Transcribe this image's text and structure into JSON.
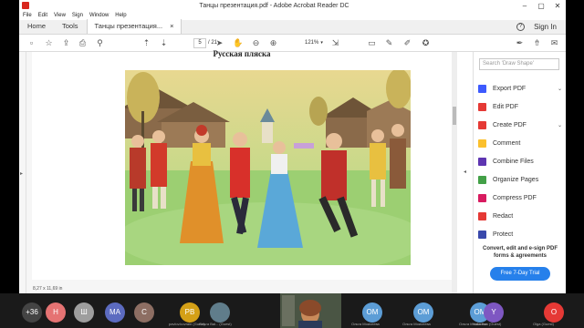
{
  "window": {
    "title": "Танцы презентация.pdf - Adobe Acrobat Reader DC",
    "controls": [
      "–",
      "▢",
      "✕"
    ]
  },
  "menu": [
    "File",
    "Edit",
    "View",
    "Sign",
    "Window",
    "Help"
  ],
  "tabs": {
    "home": "Home",
    "tools": "Tools",
    "document": "Танцы презентация...",
    "document_close": "×",
    "help": "?",
    "sign_in": "Sign In"
  },
  "toolbar": {
    "page_current": "5",
    "page_total": "/ 21",
    "zoom": "121%"
  },
  "document": {
    "heading": "Русская пляска",
    "page_size": "8,27 x 11,69 in"
  },
  "right_pane": {
    "search_placeholder": "Search 'Draw Shape'",
    "tools": [
      {
        "label": "Export PDF",
        "color": "#3d5afe",
        "has_menu": true
      },
      {
        "label": "Edit PDF",
        "color": "#e53935",
        "has_menu": false
      },
      {
        "label": "Create PDF",
        "color": "#e53935",
        "has_menu": true
      },
      {
        "label": "Comment",
        "color": "#fbc02d",
        "has_menu": false
      },
      {
        "label": "Combine Files",
        "color": "#5e35b1",
        "has_menu": false
      },
      {
        "label": "Organize Pages",
        "color": "#43a047",
        "has_menu": false
      },
      {
        "label": "Compress PDF",
        "color": "#d81b60",
        "has_menu": false
      },
      {
        "label": "Redact",
        "color": "#e53935",
        "has_menu": false
      },
      {
        "label": "Protect",
        "color": "#3949ab",
        "has_menu": false
      }
    ],
    "promo_line1": "Convert, edit and e-sign PDF",
    "promo_line2": "forms & agreements",
    "trial_button": "Free 7-Day Trial"
  },
  "participants": [
    {
      "label": "+36",
      "color": "#444444"
    },
    {
      "label": "Н",
      "color": "#e57373"
    },
    {
      "label": "Ш",
      "color": "#9e9e9e"
    },
    {
      "label": "МА",
      "color": "#5c6bc0"
    },
    {
      "label": "С",
      "color": "#8d6e63"
    },
    {
      "label": "PB",
      "color": "#d4a017",
      "name": "pavlov.kovrain (Guest)"
    },
    {
      "label": "",
      "color": "#607d8b",
      "name": "Ольга Bal... (Guest)"
    },
    {
      "label": "",
      "color": "#33402f",
      "name": ""
    },
    {
      "label": "ОМ",
      "color": "#5c9dd6",
      "name": "Ольга Моисеева"
    },
    {
      "label": "ОМ",
      "color": "#5c9dd6",
      "name": "Ольга Моисеева"
    },
    {
      "label": "ОМ",
      "color": "#5c9dd6",
      "name": "Ольга Моисеева"
    },
    {
      "label": "Y",
      "color": "#7e57c2",
      "name": "Yulia Kon (Guest)"
    },
    {
      "label": "О",
      "color": "#e53935",
      "name": "Olga (Guest)"
    }
  ]
}
